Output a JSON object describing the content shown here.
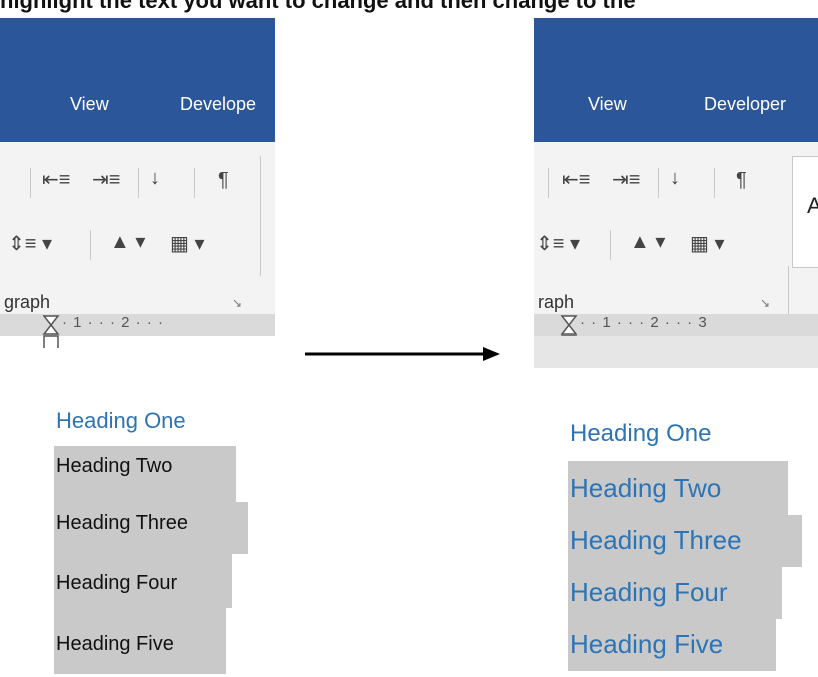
{
  "instruction_text": "highlight the text you want to change and then change to the",
  "left": {
    "tabs": [
      "View",
      "Develope"
    ],
    "group_label": "graph",
    "ruler": "· 1 · · · 2 · · ·",
    "headings": [
      "Heading One",
      "Heading Two",
      "Heading Three",
      "Heading Four",
      "Heading Five"
    ]
  },
  "right": {
    "tabs": [
      "View",
      "Developer"
    ],
    "group_label": "raph",
    "ruler": "· · 1 · · · 2 · · · 3",
    "style_gallery_partial": "A",
    "headings": [
      "Heading One",
      "Heading Two",
      "Heading Three",
      "Heading Four",
      "Heading Five"
    ]
  },
  "icons": {
    "decrease_indent": "decrease-indent-icon",
    "increase_indent": "increase-indent-icon",
    "sort": "sort-az-icon",
    "pilcrow": "show-hide-formatting-icon",
    "line_spacing": "line-spacing-icon",
    "shading": "shading-icon",
    "borders": "borders-icon",
    "launcher": "dialog-launcher-icon"
  },
  "colors": {
    "ribbon_blue": "#2b579a",
    "heading_blue": "#2e74b5",
    "highlight_gray": "#c9c9c9"
  }
}
